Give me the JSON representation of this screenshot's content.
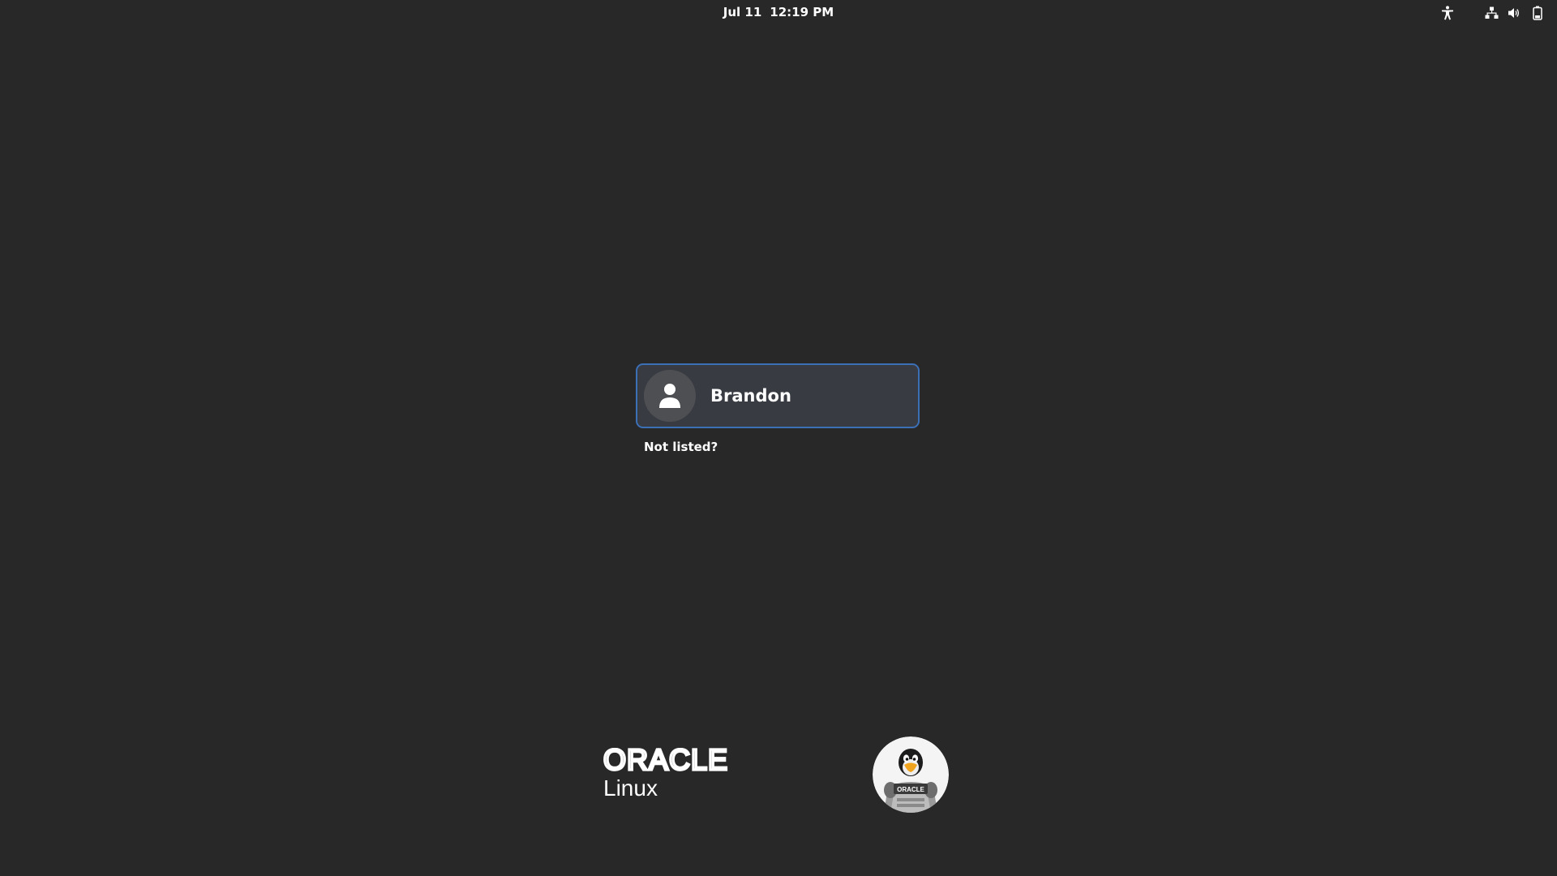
{
  "topbar": {
    "date": "Jul 11",
    "time": "12:19 PM",
    "icons": [
      "accessibility-icon",
      "network-icon",
      "volume-icon",
      "battery-icon"
    ]
  },
  "users": [
    {
      "name": "Brandon",
      "avatar_icon": "user-silhouette-icon"
    }
  ],
  "not_listed_label": "Not listed?",
  "branding": {
    "brand_name": "ORACLE",
    "product": "Linux",
    "mascot_badge_text": "ORACLE",
    "accent_color": "#3b6fb6"
  }
}
